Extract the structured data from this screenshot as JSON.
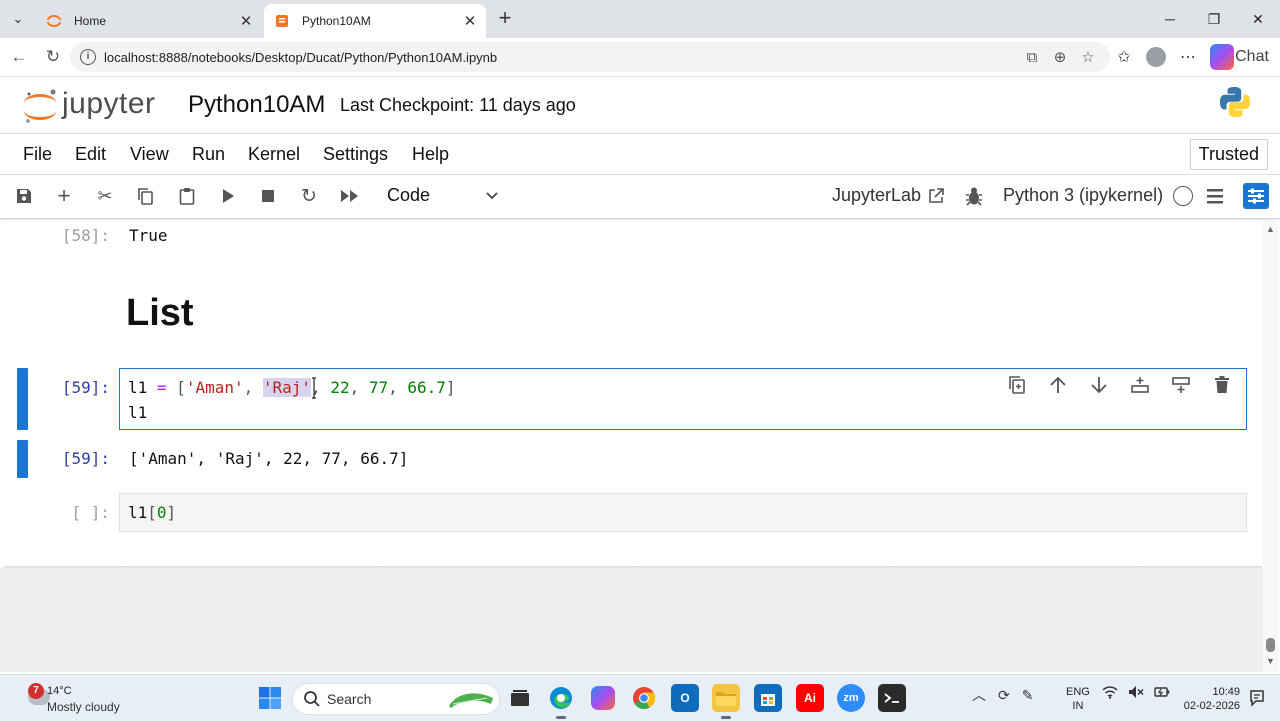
{
  "browser": {
    "tabs": [
      {
        "title": "Home",
        "active": false
      },
      {
        "title": "Python10AM",
        "active": true
      }
    ],
    "url": "localhost:8888/notebooks/Desktop/Ducat/Python/Python10AM.ipynb",
    "chat_label": "Chat"
  },
  "jupyter": {
    "logo_text": "jupyter",
    "notebook_title": "Python10AM",
    "checkpoint": "Last Checkpoint: 11 days ago",
    "menu": [
      "File",
      "Edit",
      "View",
      "Run",
      "Kernel",
      "Settings",
      "Help"
    ],
    "trusted": "Trusted",
    "cell_type": "Code",
    "jupyterlab_link": "JupyterLab",
    "kernel": "Python 3 (ipykernel)"
  },
  "cells": {
    "out58_prompt": "[58]:",
    "out58_text": "True",
    "markdown_heading": "List",
    "in59_prompt": "[59]:",
    "in59_line1": {
      "var": "l1",
      "eq": " = ",
      "open": "[",
      "s1": "'Aman'",
      "sep1": ", ",
      "s2": "'Raj'",
      "rest_sep": ", ",
      "n1": "22",
      "sep2": ", ",
      "n2": "77",
      "sep3": ", ",
      "n3": "66.7",
      "close": "]"
    },
    "in59_line2": "l1",
    "out59_prompt": "[59]:",
    "out59_text": "['Aman', 'Raj', 22, 77, 66.7]",
    "in_empty_prompt": "[ ]:",
    "in_empty_code": {
      "var": "l1",
      "open": "[",
      "idx": "0",
      "close": "]"
    }
  },
  "taskbar": {
    "weather_temp": "14°C",
    "weather_desc": "Mostly cloudy",
    "weather_badge": "7",
    "search_label": "Search",
    "lang_line1": "ENG",
    "lang_line2": "IN",
    "time": "10:49",
    "date": "02-02-2026"
  },
  "colors": {
    "accent": "#1976d2",
    "string": "#ba2121",
    "number": "#008000",
    "operator": "#aa22ff",
    "prompt_active": "#303f9f"
  }
}
